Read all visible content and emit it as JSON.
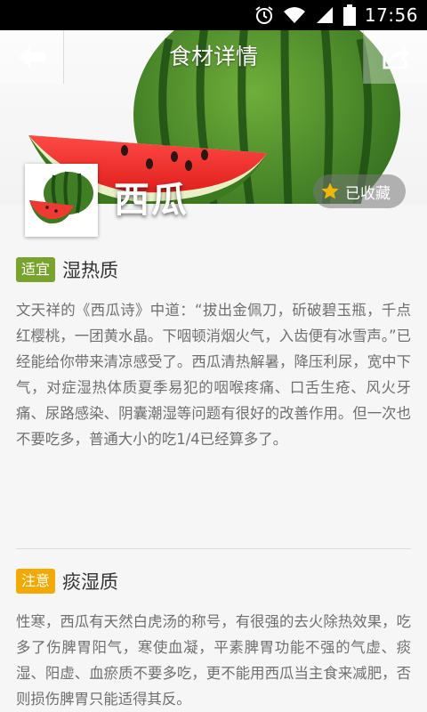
{
  "status_bar": {
    "time": "17:56"
  },
  "header": {
    "title": "食材详情"
  },
  "food": {
    "name": "西瓜",
    "favorite_label": "已收藏"
  },
  "sections": [
    {
      "tag": "适宜",
      "title": "湿热质",
      "body": "文天祥的《西瓜诗》中道：“拔出金佩刀，斫破碧玉瓶，千点红樱桃，一团黄水晶。下咽顿消烟火气，入齿便有冰雪声。”已经能给你带来清凉感受了。西瓜清热解暑，降压利尿，宽中下气，对症湿热体质夏季易犯的咽喉疼痛、口舌生疮、风火牙痛、尿路感染、阴囊潮湿等问题有很好的改善作用。但一次也不要吃多，普通大小的吃1/4已经算多了。"
    },
    {
      "tag": "注意",
      "title": "痰湿质",
      "body": "性寒，西瓜有天然白虎汤的称号，有很强的去火除热效果，吃多了伤脾胃阳气，寒使血凝，平素脾胃功能不强的气虚、痰湿、阳虚、血瘀质不要多吃，更不能用西瓜当主食来减肥，否则损伤脾胃只能适得其反。"
    }
  ],
  "colors": {
    "tag_good": "#78a32c",
    "tag_warn": "#f2a900",
    "star": "#f2b705"
  },
  "icons": [
    "alarm-icon",
    "wifi-icon",
    "signal-icon",
    "battery-icon",
    "back-arrow-icon",
    "share-icon",
    "star-icon"
  ]
}
